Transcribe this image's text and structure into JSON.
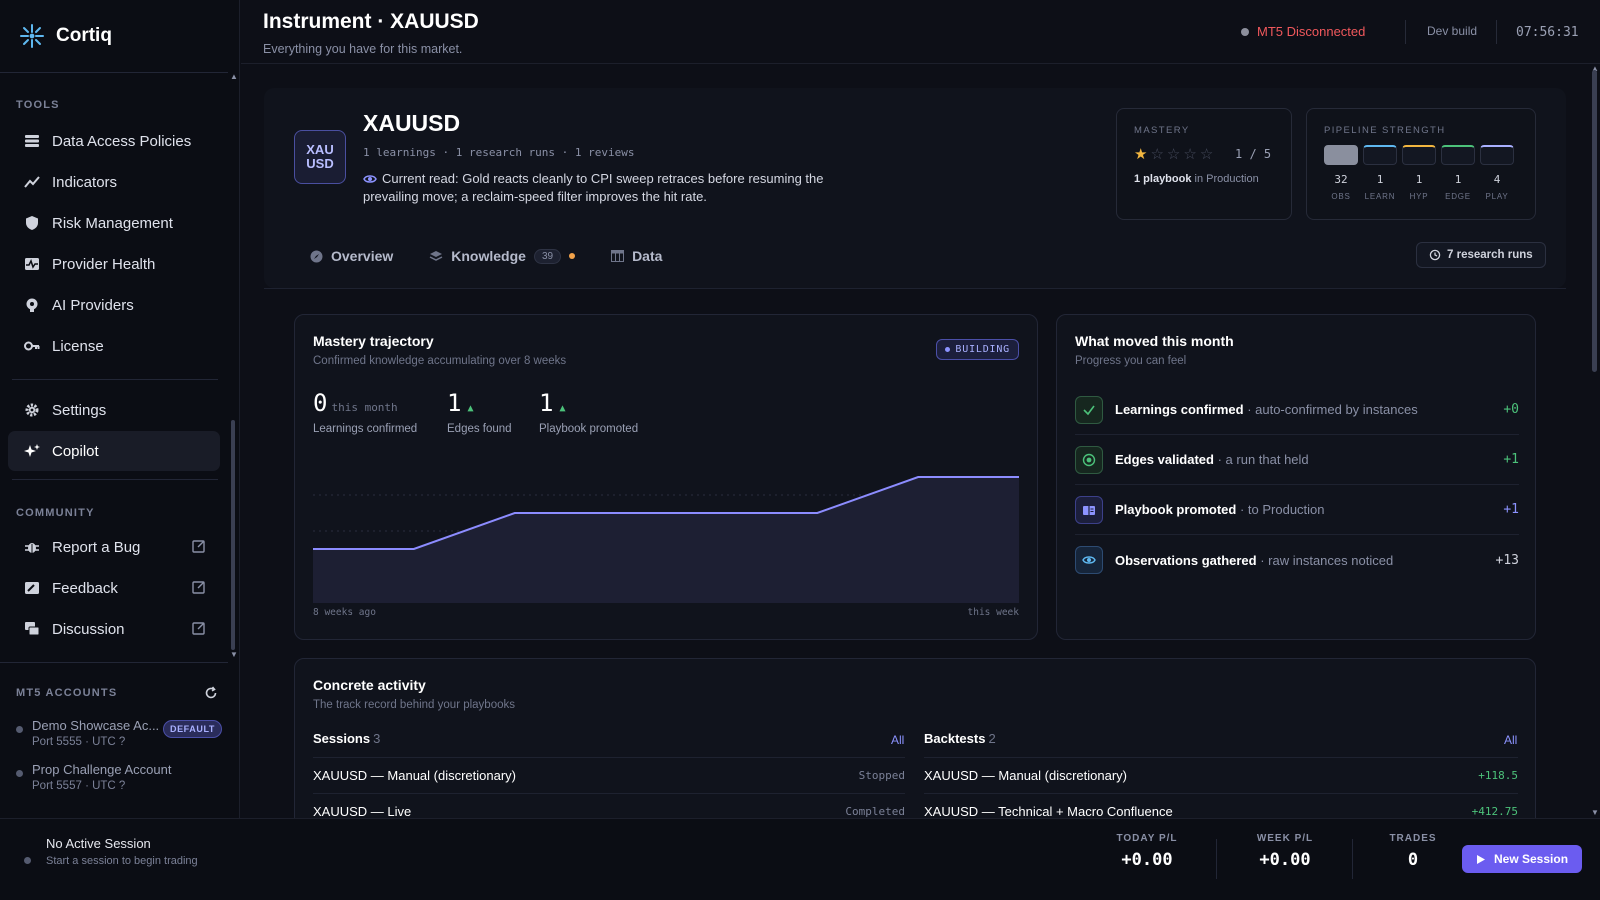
{
  "app": {
    "name": "Cortiq",
    "brand_color": "#5fb8f0",
    "accent": "#6b5cf0"
  },
  "sidebar": {
    "sections": {
      "tools": "TOOLS",
      "community": "COMMUNITY",
      "accounts": "MT5 ACCOUNTS"
    },
    "tools": [
      {
        "label": "Data Access Policies",
        "icon": "database-icon"
      },
      {
        "label": "Indicators",
        "icon": "trend-icon"
      },
      {
        "label": "Risk Management",
        "icon": "shield-icon"
      },
      {
        "label": "Provider Health",
        "icon": "heartbeat-icon"
      },
      {
        "label": "AI Providers",
        "icon": "brain-icon"
      },
      {
        "label": "License",
        "icon": "key-icon"
      }
    ],
    "settings": {
      "label": "Settings",
      "icon": "gear-icon"
    },
    "copilot": {
      "label": "Copilot",
      "icon": "sparkle-icon"
    },
    "community": [
      {
        "label": "Report a Bug",
        "icon": "bug-icon"
      },
      {
        "label": "Feedback",
        "icon": "feedback-icon"
      },
      {
        "label": "Discussion",
        "icon": "chat-icon"
      }
    ],
    "accounts": [
      {
        "name": "Demo Showcase Ac...",
        "port": "Port 5555 · UTC ?",
        "badge": "DEFAULT"
      },
      {
        "name": "Prop Challenge Account",
        "port": "Port 5557 · UTC ?"
      }
    ]
  },
  "header": {
    "title": "Instrument · XAUUSD",
    "subtitle": "Everything you have for this market.",
    "status": "MT5 Disconnected",
    "build": "Dev build",
    "clock": "07:56:31"
  },
  "instrument": {
    "logo_line1": "XAU",
    "logo_line2": "USD",
    "symbol": "XAUUSD",
    "meta": "1 learnings · 1 research runs · 1 reviews",
    "current_read": "Current read: Gold reacts cleanly to CPI sweep retraces before resuming the prevailing move; a reclaim-speed filter improves the hit rate."
  },
  "mastery": {
    "label": "MASTERY",
    "stars_filled": 1,
    "stars_total": 5,
    "value": "1 / 5",
    "playbook_bold": "1 playbook",
    "playbook_rest": " in Production"
  },
  "pipeline": {
    "label": "PIPELINE STRENGTH",
    "stages": [
      {
        "value": "32",
        "label": "OBS",
        "color": "#8a8f9e",
        "filled": true
      },
      {
        "value": "1",
        "label": "LEARN",
        "color": "#5fb8f0"
      },
      {
        "value": "1",
        "label": "HYP",
        "color": "#f2b640"
      },
      {
        "value": "1",
        "label": "EDGE",
        "color": "#4cc27a"
      },
      {
        "value": "4",
        "label": "PLAY",
        "color": "#a9b0ff"
      }
    ]
  },
  "tabs": {
    "overview": "Overview",
    "knowledge": "Knowledge",
    "knowledge_count": "39",
    "data": "Data",
    "research_runs": "7 research runs"
  },
  "trajectory": {
    "title": "Mastery trajectory",
    "subtitle": "Confirmed knowledge accumulating over 8 weeks",
    "badge": "BUILDING",
    "stats": [
      {
        "value": "0",
        "suffix": "this month",
        "label": "Learnings confirmed"
      },
      {
        "value": "1",
        "trend": "▲",
        "label": "Edges found"
      },
      {
        "value": "1",
        "trend": "▲",
        "label": "Playbook promoted"
      }
    ],
    "x_start": "8 weeks ago",
    "x_end": "this week"
  },
  "chart_data": {
    "type": "area",
    "x": [
      "8 weeks ago",
      "",
      "",
      "",
      "",
      "",
      "",
      "this week"
    ],
    "values": [
      0,
      0,
      1,
      1,
      1,
      1,
      2,
      2
    ],
    "ylim": [
      -1.5,
      2.5
    ],
    "grid": true,
    "line_color": "#8c8cff"
  },
  "moved": {
    "title": "What moved this month",
    "subtitle": "Progress you can feel",
    "rows": [
      {
        "bold": "Learnings confirmed",
        "rest": " · auto-confirmed by instances",
        "value": "+0",
        "icon": "check-icon",
        "color": "#4cc27a"
      },
      {
        "bold": "Edges validated",
        "rest": " · a run that held",
        "value": "+1",
        "icon": "target-icon",
        "color": "#4cc27a"
      },
      {
        "bold": "Playbook promoted",
        "rest": " · to Production",
        "value": "+1",
        "icon": "book-icon",
        "color": "#8c93ff"
      },
      {
        "bold": "Observations gathered",
        "rest": " · raw instances noticed",
        "value": "+13",
        "icon": "eye-icon",
        "color": "#cfd2dc"
      }
    ]
  },
  "activity": {
    "title": "Concrete activity",
    "subtitle": "The track record behind your playbooks",
    "sessions_label": "Sessions",
    "sessions_count": "3",
    "backtests_label": "Backtests",
    "backtests_count": "2",
    "all": "All",
    "sessions": [
      {
        "name": "XAUUSD — Manual (discretionary)",
        "status": "Stopped"
      },
      {
        "name": "XAUUSD — Live",
        "status": "Completed"
      }
    ],
    "backtests": [
      {
        "name": "XAUUSD — Manual (discretionary)",
        "pnl": "+118.5"
      },
      {
        "name": "XAUUSD — Technical + Macro Confluence",
        "pnl": "+412.75"
      }
    ]
  },
  "footer": {
    "session_title": "No Active Session",
    "session_sub": "Start a session to begin trading",
    "today_label": "TODAY P/L",
    "today_value": "+0.00",
    "week_label": "WEEK P/L",
    "week_value": "+0.00",
    "trades_label": "TRADES",
    "trades_value": "0",
    "new_session": "New Session"
  }
}
